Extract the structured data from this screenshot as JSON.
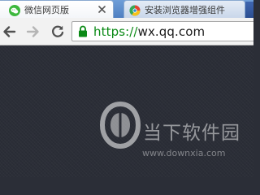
{
  "tabs": [
    {
      "title": "微信网页版",
      "favicon": "wechat-icon",
      "active": true
    },
    {
      "title": "安装浏览器增强组件",
      "favicon": "browser-logo-icon",
      "active": false
    }
  ],
  "toolbar": {
    "back_icon": "back-arrow-icon",
    "forward_icon": "forward-arrow-icon",
    "reload_icon": "reload-icon"
  },
  "omnibox": {
    "secure_icon": "lock-icon",
    "scheme": "https://",
    "host": "wx.qq.com"
  },
  "watermark": {
    "logo": "downxia-logo",
    "brand": "当下软件园",
    "url": "www.downxia.com"
  },
  "colors": {
    "secure_green": "#0b8a16",
    "page_background": "#2b2e37",
    "wechat_green": "#3db83d"
  }
}
